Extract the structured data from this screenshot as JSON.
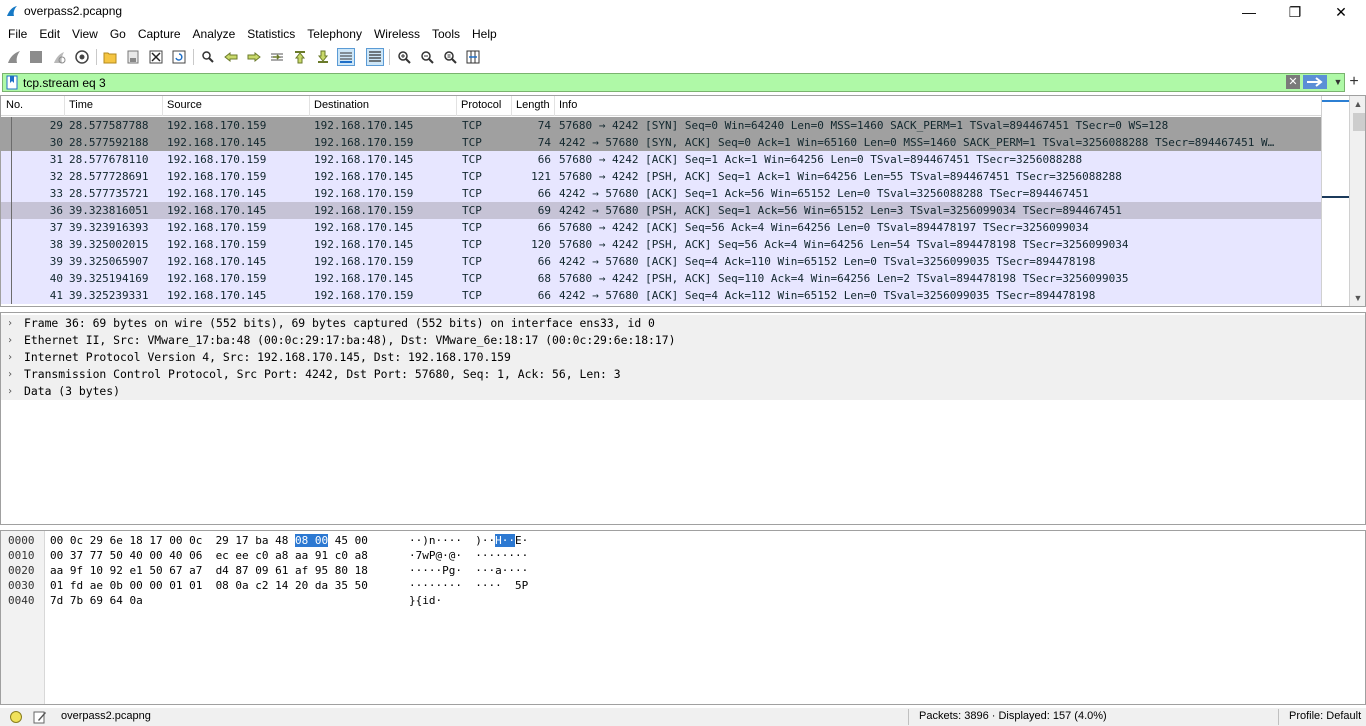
{
  "window": {
    "title": "overpass2.pcapng",
    "minimize": "—",
    "maximize": "❐",
    "close": "✕"
  },
  "menu": [
    "File",
    "Edit",
    "View",
    "Go",
    "Capture",
    "Analyze",
    "Statistics",
    "Telephony",
    "Wireless",
    "Tools",
    "Help"
  ],
  "filter": {
    "value": "tcp.stream eq 3",
    "clear": "✕"
  },
  "packet_list": {
    "columns": [
      "No.",
      "Time",
      "Source",
      "Destination",
      "Protocol",
      "Length",
      "Info"
    ],
    "rows": [
      {
        "no": "29",
        "time": "28.577587788",
        "src": "192.168.170.159",
        "dst": "192.168.170.145",
        "proto": "TCP",
        "len": "74",
        "info": "57680 → 4242 [SYN] Seq=0 Win=64240 Len=0 MSS=1460 SACK_PERM=1 TSval=894467451 TSecr=0 WS=128"
      },
      {
        "no": "30",
        "time": "28.577592188",
        "src": "192.168.170.145",
        "dst": "192.168.170.159",
        "proto": "TCP",
        "len": "74",
        "info": "4242 → 57680 [SYN, ACK] Seq=0 Ack=1 Win=65160 Len=0 MSS=1460 SACK_PERM=1 TSval=3256088288 TSecr=894467451 W…"
      },
      {
        "no": "31",
        "time": "28.577678110",
        "src": "192.168.170.159",
        "dst": "192.168.170.145",
        "proto": "TCP",
        "len": "66",
        "info": "57680 → 4242 [ACK] Seq=1 Ack=1 Win=64256 Len=0 TSval=894467451 TSecr=3256088288"
      },
      {
        "no": "32",
        "time": "28.577728691",
        "src": "192.168.170.159",
        "dst": "192.168.170.145",
        "proto": "TCP",
        "len": "121",
        "info": "57680 → 4242 [PSH, ACK] Seq=1 Ack=1 Win=64256 Len=55 TSval=894467451 TSecr=3256088288"
      },
      {
        "no": "33",
        "time": "28.577735721",
        "src": "192.168.170.145",
        "dst": "192.168.170.159",
        "proto": "TCP",
        "len": "66",
        "info": "4242 → 57680 [ACK] Seq=1 Ack=56 Win=65152 Len=0 TSval=3256088288 TSecr=894467451"
      },
      {
        "no": "36",
        "time": "39.323816051",
        "src": "192.168.170.145",
        "dst": "192.168.170.159",
        "proto": "TCP",
        "len": "69",
        "info": "4242 → 57680 [PSH, ACK] Seq=1 Ack=56 Win=65152 Len=3 TSval=3256099034 TSecr=894467451"
      },
      {
        "no": "37",
        "time": "39.323916393",
        "src": "192.168.170.159",
        "dst": "192.168.170.145",
        "proto": "TCP",
        "len": "66",
        "info": "57680 → 4242 [ACK] Seq=56 Ack=4 Win=64256 Len=0 TSval=894478197 TSecr=3256099034"
      },
      {
        "no": "38",
        "time": "39.325002015",
        "src": "192.168.170.159",
        "dst": "192.168.170.145",
        "proto": "TCP",
        "len": "120",
        "info": "57680 → 4242 [PSH, ACK] Seq=56 Ack=4 Win=64256 Len=54 TSval=894478198 TSecr=3256099034"
      },
      {
        "no": "39",
        "time": "39.325065907",
        "src": "192.168.170.145",
        "dst": "192.168.170.159",
        "proto": "TCP",
        "len": "66",
        "info": "4242 → 57680 [ACK] Seq=4 Ack=110 Win=65152 Len=0 TSval=3256099035 TSecr=894478198"
      },
      {
        "no": "40",
        "time": "39.325194169",
        "src": "192.168.170.159",
        "dst": "192.168.170.145",
        "proto": "TCP",
        "len": "68",
        "info": "57680 → 4242 [PSH, ACK] Seq=110 Ack=4 Win=64256 Len=2 TSval=894478198 TSecr=3256099035"
      },
      {
        "no": "41",
        "time": "39.325239331",
        "src": "192.168.170.145",
        "dst": "192.168.170.159",
        "proto": "TCP",
        "len": "66",
        "info": "4242 → 57680 [ACK] Seq=4 Ack=112 Win=65152 Len=0 TSval=3256099035 TSecr=894478198"
      }
    ]
  },
  "colors": {
    "syn_row": "#a0a0a0",
    "selected_row": "#c6c3d6",
    "tcp_row": "#e7e6ff",
    "text": "#12272e",
    "filter_ok": "#aff9a7",
    "byte_highlight": "#2d79d2"
  },
  "details": {
    "chevron": "›",
    "items": [
      "Frame 36: 69 bytes on wire (552 bits), 69 bytes captured (552 bits) on interface ens33, id 0",
      "Ethernet II, Src: VMware_17:ba:48 (00:0c:29:17:ba:48), Dst: VMware_6e:18:17 (00:0c:29:6e:18:17)",
      "Internet Protocol Version 4, Src: 192.168.170.145, Dst: 192.168.170.159",
      "Transmission Control Protocol, Src Port: 4242, Dst Port: 57680, Seq: 1, Ack: 56, Len: 3",
      "Data (3 bytes)"
    ]
  },
  "bytes": {
    "rows": [
      {
        "offset": "0000",
        "hex_a": "00 0c 29 6e 18 17 00 0c  29 17 ba 48 ",
        "hex_hl": "08 00",
        "hex_b": " 45 00",
        "asc_a": "··)n····  )··",
        "asc_hl": "H··",
        "asc_b": "E·"
      },
      {
        "offset": "0010",
        "hex_a": "00 37 77 50 40 00 40 06  ec ee c0 a8 aa 91 c0 a8",
        "hex_hl": "",
        "hex_b": "",
        "asc_a": "·7wP@·@·  ········",
        "asc_hl": "",
        "asc_b": ""
      },
      {
        "offset": "0020",
        "hex_a": "aa 9f 10 92 e1 50 67 a7  d4 87 09 61 af 95 80 18",
        "hex_hl": "",
        "hex_b": "",
        "asc_a": "·····Pg·  ···a····",
        "asc_hl": "",
        "asc_b": ""
      },
      {
        "offset": "0030",
        "hex_a": "01 fd ae 0b 00 00 01 01  08 0a c2 14 20 da 35 50",
        "hex_hl": "",
        "hex_b": "",
        "asc_a": "········  ····  5P",
        "asc_hl": "",
        "asc_b": ""
      },
      {
        "offset": "0040",
        "hex_a": "7d 7b 69 64 0a",
        "hex_hl": "",
        "hex_b": "",
        "asc_a": "}{id·",
        "asc_hl": "",
        "asc_b": ""
      }
    ]
  },
  "status": {
    "file": "overpass2.pcapng",
    "packets": "Packets: 3896 · Displayed: 157 (4.0%)",
    "profile": "Profile: Default"
  }
}
